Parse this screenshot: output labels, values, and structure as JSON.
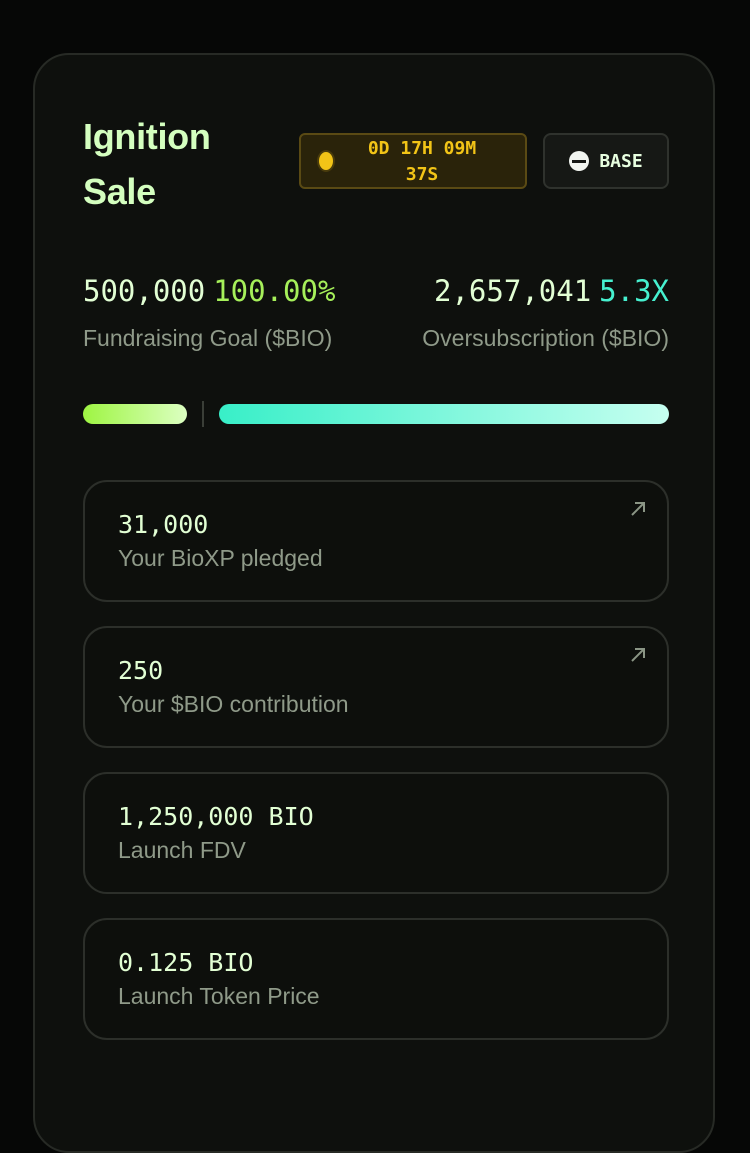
{
  "sale": {
    "title": "Ignition Sale",
    "countdown_line1": "0D 17H 09M",
    "countdown_line2": "37S",
    "chain_label": "BASE",
    "chain_icon": "base-network-icon"
  },
  "stats": {
    "goal_amount": "500,000",
    "goal_percent": "100.00%",
    "goal_label": "Fundraising Goal ($BIO)",
    "oversub_amount": "2,657,041",
    "oversub_multiplier": "5.3X",
    "oversub_label": "Oversubscription ($BIO)",
    "goal_progress_fraction": 1.0,
    "oversubscription_multiple": 5.3
  },
  "cards": [
    {
      "value": "31,000",
      "label": "Your BioXP pledged",
      "icon": "external-arrow-icon"
    },
    {
      "value": "250",
      "label": "Your $BIO contribution",
      "icon": "external-arrow-icon"
    },
    {
      "value": "1,250,000 BIO",
      "label": "Launch FDV"
    },
    {
      "value": "0.125 BIO",
      "label": "Launch Token Price"
    }
  ],
  "colors": {
    "accent_green": "#a6f05a",
    "accent_teal": "#46f0cf",
    "countdown_yellow": "#f2c417",
    "title_text": "#d4ffbf"
  }
}
